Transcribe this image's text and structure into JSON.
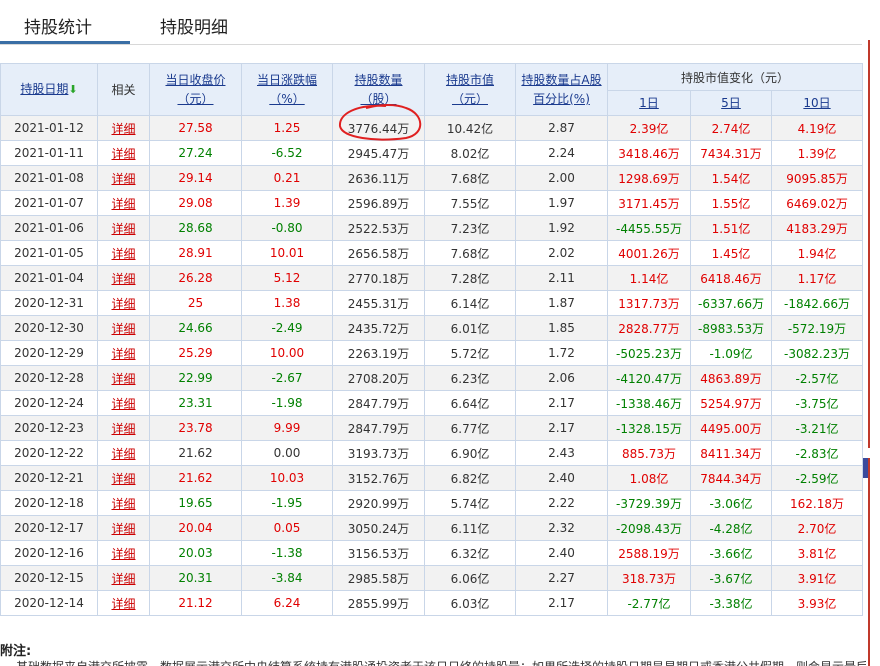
{
  "tabs": [
    {
      "label": "持股统计",
      "active": true
    },
    {
      "label": "持股明细",
      "active": false
    }
  ],
  "header": {
    "date": "持股日期",
    "related": "相关",
    "close_price_line1": "当日收盘价",
    "close_price_line2": "（元）",
    "change_line1": "当日涨跌幅",
    "change_line2": "（%）",
    "shares_line1": "持股数量",
    "shares_line2": "（股）",
    "value_line1": "持股市值",
    "value_line2": "（元）",
    "pct_line1": "持股数量占A股",
    "pct_line2": "百分比(%)",
    "delta_group": "持股市值变化（元）",
    "delta_1d": "1日",
    "delta_5d": "5日",
    "delta_10d": "10日"
  },
  "detail_label": "详细",
  "rows": [
    {
      "date": "2021-01-12",
      "close": "27.58",
      "chg": "1.25",
      "shares": "3776.44万",
      "value": "10.42亿",
      "pct": "2.87",
      "d1": "2.39亿",
      "d5": "2.74亿",
      "d10": "4.19亿"
    },
    {
      "date": "2021-01-11",
      "close": "27.24",
      "chg": "-6.52",
      "shares": "2945.47万",
      "value": "8.02亿",
      "pct": "2.24",
      "d1": "3418.46万",
      "d5": "7434.31万",
      "d10": "1.39亿"
    },
    {
      "date": "2021-01-08",
      "close": "29.14",
      "chg": "0.21",
      "shares": "2636.11万",
      "value": "7.68亿",
      "pct": "2.00",
      "d1": "1298.69万",
      "d5": "1.54亿",
      "d10": "9095.85万"
    },
    {
      "date": "2021-01-07",
      "close": "29.08",
      "chg": "1.39",
      "shares": "2596.89万",
      "value": "7.55亿",
      "pct": "1.97",
      "d1": "3171.45万",
      "d5": "1.55亿",
      "d10": "6469.02万"
    },
    {
      "date": "2021-01-06",
      "close": "28.68",
      "chg": "-0.80",
      "shares": "2522.53万",
      "value": "7.23亿",
      "pct": "1.92",
      "d1": "-4455.55万",
      "d5": "1.51亿",
      "d10": "4183.29万"
    },
    {
      "date": "2021-01-05",
      "close": "28.91",
      "chg": "10.01",
      "shares": "2656.58万",
      "value": "7.68亿",
      "pct": "2.02",
      "d1": "4001.26万",
      "d5": "1.45亿",
      "d10": "1.94亿"
    },
    {
      "date": "2021-01-04",
      "close": "26.28",
      "chg": "5.12",
      "shares": "2770.18万",
      "value": "7.28亿",
      "pct": "2.11",
      "d1": "1.14亿",
      "d5": "6418.46万",
      "d10": "1.17亿"
    },
    {
      "date": "2020-12-31",
      "close": "25",
      "chg": "1.38",
      "shares": "2455.31万",
      "value": "6.14亿",
      "pct": "1.87",
      "d1": "1317.73万",
      "d5": "-6337.66万",
      "d10": "-1842.66万"
    },
    {
      "date": "2020-12-30",
      "close": "24.66",
      "chg": "-2.49",
      "shares": "2435.72万",
      "value": "6.01亿",
      "pct": "1.85",
      "d1": "2828.77万",
      "d5": "-8983.53万",
      "d10": "-572.19万"
    },
    {
      "date": "2020-12-29",
      "close": "25.29",
      "chg": "10.00",
      "shares": "2263.19万",
      "value": "5.72亿",
      "pct": "1.72",
      "d1": "-5025.23万",
      "d5": "-1.09亿",
      "d10": "-3082.23万"
    },
    {
      "date": "2020-12-28",
      "close": "22.99",
      "chg": "-2.67",
      "shares": "2708.20万",
      "value": "6.23亿",
      "pct": "2.06",
      "d1": "-4120.47万",
      "d5": "4863.89万",
      "d10": "-2.57亿"
    },
    {
      "date": "2020-12-24",
      "close": "23.31",
      "chg": "-1.98",
      "shares": "2847.79万",
      "value": "6.64亿",
      "pct": "2.17",
      "d1": "-1338.46万",
      "d5": "5254.97万",
      "d10": "-3.75亿"
    },
    {
      "date": "2020-12-23",
      "close": "23.78",
      "chg": "9.99",
      "shares": "2847.79万",
      "value": "6.77亿",
      "pct": "2.17",
      "d1": "-1328.15万",
      "d5": "4495.00万",
      "d10": "-3.21亿"
    },
    {
      "date": "2020-12-22",
      "close": "21.62",
      "chg": "0.00",
      "shares": "3193.73万",
      "value": "6.90亿",
      "pct": "2.43",
      "d1": "885.73万",
      "d5": "8411.34万",
      "d10": "-2.83亿"
    },
    {
      "date": "2020-12-21",
      "close": "21.62",
      "chg": "10.03",
      "shares": "3152.76万",
      "value": "6.82亿",
      "pct": "2.40",
      "d1": "1.08亿",
      "d5": "7844.34万",
      "d10": "-2.59亿"
    },
    {
      "date": "2020-12-18",
      "close": "19.65",
      "chg": "-1.95",
      "shares": "2920.99万",
      "value": "5.74亿",
      "pct": "2.22",
      "d1": "-3729.39万",
      "d5": "-3.06亿",
      "d10": "162.18万"
    },
    {
      "date": "2020-12-17",
      "close": "20.04",
      "chg": "0.05",
      "shares": "3050.24万",
      "value": "6.11亿",
      "pct": "2.32",
      "d1": "-2098.43万",
      "d5": "-4.28亿",
      "d10": "2.70亿"
    },
    {
      "date": "2020-12-16",
      "close": "20.03",
      "chg": "-1.38",
      "shares": "3156.53万",
      "value": "6.32亿",
      "pct": "2.40",
      "d1": "2588.19万",
      "d5": "-3.66亿",
      "d10": "3.81亿"
    },
    {
      "date": "2020-12-15",
      "close": "20.31",
      "chg": "-3.84",
      "shares": "2985.58万",
      "value": "6.06亿",
      "pct": "2.27",
      "d1": "318.73万",
      "d5": "-3.67亿",
      "d10": "3.91亿"
    },
    {
      "date": "2020-12-14",
      "close": "21.12",
      "chg": "6.24",
      "shares": "2855.99万",
      "value": "6.03亿",
      "pct": "2.17",
      "d1": "-2.77亿",
      "d5": "-3.38亿",
      "d10": "3.93亿"
    }
  ],
  "note": {
    "title": "附注:",
    "text": "基础数据来自港交所披露，数据展示港交所中央结算系统持有港股通投资者于该日日终的持股量；如果所选择的持股日期是星期日或香港公共假期，则会显示最后一个非星"
  },
  "colors": {
    "up": "#e00000",
    "down": "#008000",
    "link": "#1a3a8e",
    "detail": "#cc0000",
    "header_bg": "#e6eef9",
    "annotation": "#e02020"
  }
}
